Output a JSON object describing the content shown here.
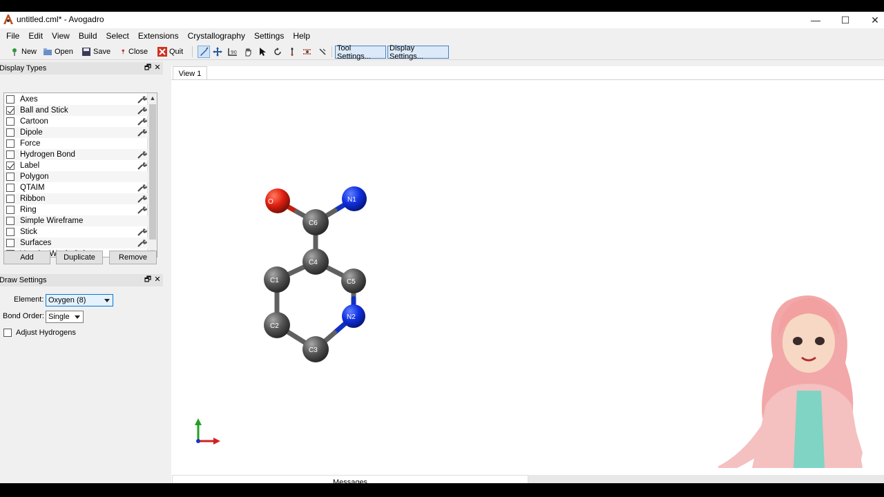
{
  "window": {
    "title": "untitled.cml* - Avogadro",
    "minimize_glyph": "—",
    "maximize_glyph": "☐",
    "close_glyph": "✕"
  },
  "menu": [
    "File",
    "Edit",
    "View",
    "Build",
    "Select",
    "Extensions",
    "Crystallography",
    "Settings",
    "Help"
  ],
  "toolbar": {
    "new_label": "New",
    "open_label": "Open",
    "save_label": "Save",
    "close_label": "Close",
    "quit_label": "Quit",
    "tools": [
      "draw-tool-icon",
      "navigate-tool-icon",
      "measure-tool-icon",
      "manipulate-tool-icon",
      "select-tool-icon",
      "rotate-tool-icon",
      "align-tool-icon",
      "autooptimize-tool-icon",
      "bond-centric-tool-icon"
    ],
    "tool_settings_label": "Tool Settings...",
    "display_settings_label": "Display Settings..."
  },
  "display_types": {
    "title": "Display Types",
    "items": [
      {
        "label": "Axes",
        "checked": false,
        "configurable": true
      },
      {
        "label": "Ball and Stick",
        "checked": true,
        "configurable": true
      },
      {
        "label": "Cartoon",
        "checked": false,
        "configurable": true
      },
      {
        "label": "Dipole",
        "checked": false,
        "configurable": true
      },
      {
        "label": "Force",
        "checked": false,
        "configurable": false
      },
      {
        "label": "Hydrogen Bond",
        "checked": false,
        "configurable": true
      },
      {
        "label": "Label",
        "checked": true,
        "configurable": true
      },
      {
        "label": "Polygon",
        "checked": false,
        "configurable": false
      },
      {
        "label": "QTAIM",
        "checked": false,
        "configurable": true
      },
      {
        "label": "Ribbon",
        "checked": false,
        "configurable": true
      },
      {
        "label": "Ring",
        "checked": false,
        "configurable": true
      },
      {
        "label": "Simple Wireframe",
        "checked": false,
        "configurable": false
      },
      {
        "label": "Stick",
        "checked": false,
        "configurable": true
      },
      {
        "label": "Surfaces",
        "checked": false,
        "configurable": true
      },
      {
        "label": "Van der Waals Spheres",
        "checked": false,
        "configurable": true
      }
    ],
    "add_label": "Add",
    "duplicate_label": "Duplicate",
    "remove_label": "Remove"
  },
  "draw_settings": {
    "title": "Draw Settings",
    "element_label": "Element:",
    "element_value": "Oxygen (8)",
    "bond_order_label": "Bond Order:",
    "bond_order_value": "Single",
    "adjust_hydrogens_label": "Adjust Hydrogens",
    "adjust_hydrogens_checked": false
  },
  "view": {
    "tab_label": "View 1",
    "messages_label": "Messages",
    "atoms": [
      {
        "label": "O",
        "element": "oxygen",
        "color": "#e03010"
      },
      {
        "label": "N1",
        "element": "nitrogen",
        "color": "#1030e0"
      },
      {
        "label": "C6",
        "element": "carbon",
        "color": "#5a5a5a"
      },
      {
        "label": "C4",
        "element": "carbon",
        "color": "#5a5a5a"
      },
      {
        "label": "C1",
        "element": "carbon",
        "color": "#5a5a5a"
      },
      {
        "label": "C5",
        "element": "carbon",
        "color": "#5a5a5a"
      },
      {
        "label": "N2",
        "element": "nitrogen",
        "color": "#1030e0"
      },
      {
        "label": "C2",
        "element": "carbon",
        "color": "#5a5a5a"
      },
      {
        "label": "C3",
        "element": "carbon",
        "color": "#5a5a5a"
      }
    ],
    "bonds": [
      [
        "O",
        "C6"
      ],
      [
        "N1",
        "C6"
      ],
      [
        "C6",
        "C4"
      ],
      [
        "C4",
        "C1"
      ],
      [
        "C4",
        "C5"
      ],
      [
        "C5",
        "N2"
      ],
      [
        "N2",
        "C3"
      ],
      [
        "C3",
        "C2"
      ],
      [
        "C2",
        "C1"
      ]
    ]
  }
}
